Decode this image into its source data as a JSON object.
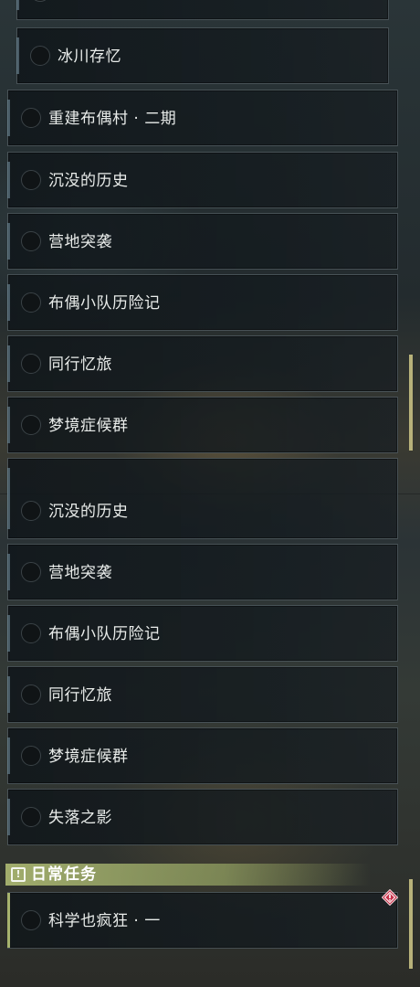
{
  "top_panel": {
    "quests": [
      {
        "label": ""
      },
      {
        "label": "冰川存忆"
      },
      {
        "label": "重建布偶村 · 二期"
      },
      {
        "label": "沉没的历史"
      },
      {
        "label": "营地突袭"
      },
      {
        "label": "布偶小队历险记"
      },
      {
        "label": "同行忆旅"
      },
      {
        "label": "梦境症候群"
      },
      {
        "label": ""
      }
    ]
  },
  "bottom_panel": {
    "quests": [
      {
        "label": "沉没的历史"
      },
      {
        "label": "营地突袭"
      },
      {
        "label": "布偶小队历险记"
      },
      {
        "label": "同行忆旅"
      },
      {
        "label": "梦境症候群"
      },
      {
        "label": "失落之影"
      }
    ],
    "daily_section": {
      "icon": "exclamation-box-icon",
      "icon_glyph": "!",
      "title": "日常任务",
      "quests": [
        {
          "label": "科学也疯狂 · 一",
          "badge": "warning-diamond-icon"
        }
      ]
    }
  },
  "colors": {
    "accent_daily": "#a7b36e",
    "badge_red": "#c8324a",
    "text": "#e9ecea"
  }
}
